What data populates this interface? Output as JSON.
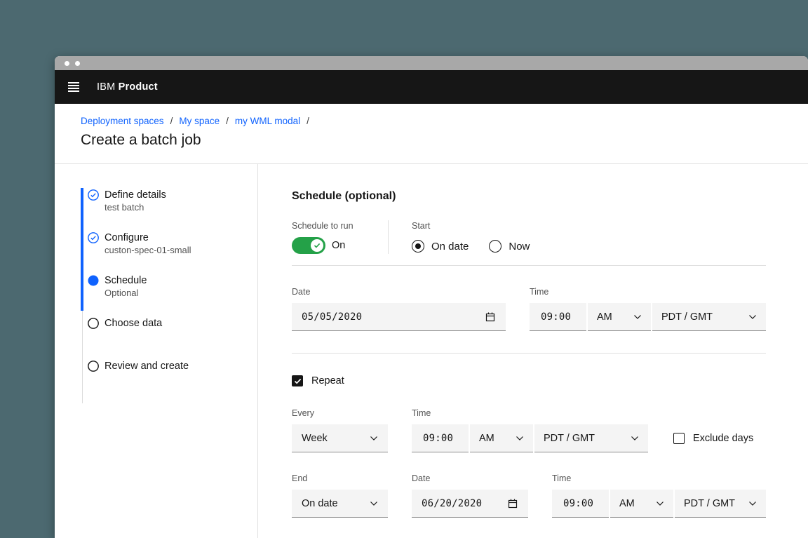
{
  "window": {
    "app_header": {
      "brand_prefix": "IBM",
      "brand_name": "Product"
    }
  },
  "breadcrumb": {
    "separator": "/",
    "items": [
      "Deployment spaces",
      "My space",
      "my WML modal"
    ]
  },
  "page": {
    "title": "Create a batch job"
  },
  "progress_steps": [
    {
      "label": "Define details",
      "sublabel": "test batch",
      "state": "complete"
    },
    {
      "label": "Configure",
      "sublabel": "custon-spec-01-small",
      "state": "complete"
    },
    {
      "label": "Schedule",
      "sublabel": "Optional",
      "state": "current"
    },
    {
      "label": "Choose data",
      "sublabel": "",
      "state": "incomplete"
    },
    {
      "label": "Review and create",
      "sublabel": "",
      "state": "incomplete"
    }
  ],
  "schedule_form": {
    "heading": "Schedule (optional)",
    "schedule_to_run": {
      "label": "Schedule to run",
      "value": "On",
      "enabled": true
    },
    "start": {
      "label": "Start",
      "options": [
        {
          "label": "On date",
          "selected": true
        },
        {
          "label": "Now",
          "selected": false
        }
      ]
    },
    "start_date": {
      "label": "Date",
      "value": "05/05/2020"
    },
    "start_time": {
      "label": "Time",
      "value": "09:00",
      "meridiem": "AM",
      "timezone": "PDT / GMT"
    },
    "repeat": {
      "label": "Repeat",
      "checked": true
    },
    "every": {
      "label": "Every",
      "value": "Week"
    },
    "repeat_time": {
      "label": "Time",
      "value": "09:00",
      "meridiem": "AM",
      "timezone": "PDT / GMT"
    },
    "exclude_days": {
      "label": "Exclude days",
      "checked": false
    },
    "end": {
      "label": "End",
      "value": "On date"
    },
    "end_date": {
      "label": "Date",
      "value": "06/20/2020"
    },
    "end_time": {
      "label": "Time",
      "value": "09:00",
      "meridiem": "AM",
      "timezone": "PDT / GMT"
    }
  },
  "colors": {
    "accent_blue": "#0f62fe",
    "toggle_green": "#24a148",
    "header_black": "#161616",
    "field_bg": "#f4f4f4",
    "page_bg_teal": "#4c6970",
    "titlebar_gray": "#a8a8a8"
  }
}
